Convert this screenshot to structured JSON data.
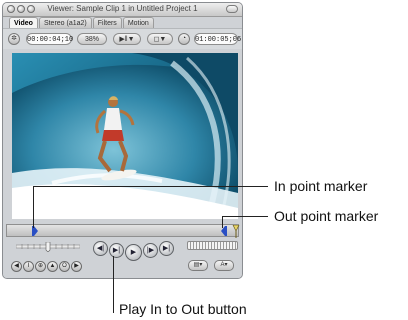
{
  "window": {
    "title": "Viewer: Sample Clip 1 in Untitled Project 1"
  },
  "tabs": [
    {
      "label": "Video",
      "active": true
    },
    {
      "label": "Stereo (a1a2)",
      "active": false
    },
    {
      "label": "Filters",
      "active": false
    },
    {
      "label": "Motion",
      "active": false
    }
  ],
  "toolbar": {
    "timecode_current": "00:00:04;10",
    "zoom": "38%",
    "view_popup": "▶‖▼",
    "overlay_popup": "◻▼",
    "timecode_duration": "01:00:05;06"
  },
  "callouts": {
    "in_point": "In point marker",
    "out_point": "Out point marker",
    "play_in_to_out": "Play In to Out button"
  },
  "transport": {
    "prev_edit": "◀|",
    "play_in_out": "▶|",
    "play": "▶",
    "play_around": "|▶",
    "next_edit": "▶|",
    "mark_clip_label": "⊕"
  },
  "colors": {
    "window_bg": "#cfd2d6",
    "video_sky": "#1d6c8f",
    "marker_blue": "#2a4fc4"
  }
}
